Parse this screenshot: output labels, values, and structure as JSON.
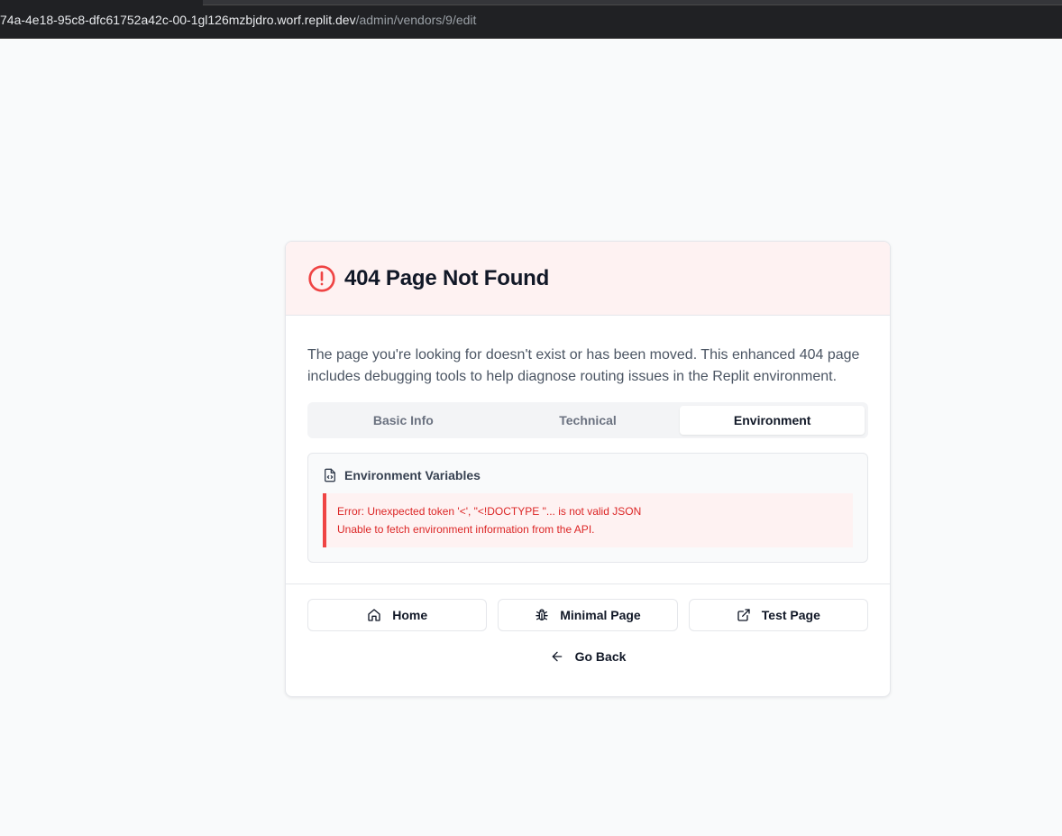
{
  "browser": {
    "url_host": "74a-4e18-95c8-dfc61752a42c-00-1gl126mzbjdro.worf.replit.dev",
    "url_path": "/admin/vendors/9/edit"
  },
  "card": {
    "title": "404 Page Not Found",
    "title_icon": "alert-circle-icon",
    "description": "The page you're looking for doesn't exist or has been moved. This enhanced 404 page includes debugging tools to help diagnose routing issues in the Replit environment.",
    "tabs": [
      {
        "label": "Basic Info",
        "active": false
      },
      {
        "label": "Technical",
        "active": false
      },
      {
        "label": "Environment",
        "active": true
      }
    ],
    "env": {
      "title": "Environment Variables",
      "icon": "file-code-icon",
      "error_line1": "Error: Unexpected token '<', \"<!DOCTYPE \"... is not valid JSON",
      "error_line2": "Unable to fetch environment information from the API."
    },
    "buttons": {
      "home": "Home",
      "minimal": "Minimal Page",
      "test": "Test Page",
      "back": "Go Back"
    }
  },
  "colors": {
    "header_bg": "#fef2f2",
    "error_accent": "#ef4444",
    "error_text": "#dc2626"
  }
}
